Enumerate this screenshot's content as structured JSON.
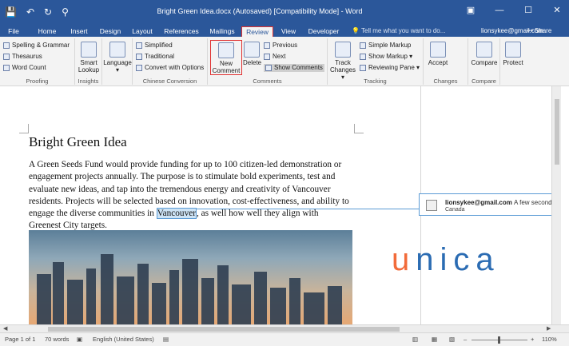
{
  "titlebar": {
    "title": "Bright Green Idea.docx (Autosaved) [Compatibility Mode] - Word",
    "save_icon": "💾",
    "undo_icon": "↶",
    "redo_icon": "↻",
    "qat_more": "⚲",
    "win_ribbon": "▣",
    "win_min": "—",
    "win_max": "☐",
    "win_close": "✕"
  },
  "tabs": [
    "File",
    "Home",
    "Insert",
    "Design",
    "Layout",
    "References",
    "Mailings",
    "Review",
    "View",
    "Developer"
  ],
  "tellme": "💡 Tell me what you want to do...",
  "user": "lionsykee@gmail.com",
  "share": "⚯ Share",
  "ribbon": {
    "proofing": {
      "spelling": "Spelling & Grammar",
      "thesaurus": "Thesaurus",
      "wordcount": "Word Count",
      "label": "Proofing"
    },
    "insights": {
      "smart_lookup_1": "Smart",
      "smart_lookup_2": "Lookup",
      "label": "Insights"
    },
    "language": {
      "btn": "Language",
      "dd": "▾"
    },
    "chinese": {
      "simplified": "Simplified",
      "traditional": "Traditional",
      "convert": "Convert with Options",
      "label": "Chinese Conversion"
    },
    "comments": {
      "new_1": "New",
      "new_2": "Comment",
      "delete": "Delete",
      "previous": "Previous",
      "next": "Next",
      "show": "Show Comments",
      "label": "Comments"
    },
    "tracking": {
      "track_1": "Track",
      "track_2": "Changes ▾",
      "markup": "Simple Markup",
      "show_markup": "Show Markup ▾",
      "reviewing": "Reviewing Pane ▾",
      "label": "Tracking"
    },
    "changes": {
      "accept": "Accept",
      "label": "Changes"
    },
    "compare": {
      "btn": "Compare",
      "label": "Compare"
    },
    "protect": {
      "btn": "Protect"
    }
  },
  "document": {
    "heading": "Bright Green Idea",
    "para_1": " A Green Seeds Fund would provide funding for up to 100 citizen-led demonstration or engagement projects annually. The purpose is to stimulate bold experiments, test and evaluate new ideas, and tap into the tremendous energy and creativity of Vancouver residents. Projects will be selected based on innovation, cost-effectiveness, and ability to engage the diverse communities in ",
    "highlight": "Vancouver",
    "para_2": ", as well how well they align with Greenest City targets."
  },
  "comment": {
    "user": "lionsykee@gmail.com",
    "time": "A few seconds",
    "location": "Canada"
  },
  "watermark": {
    "u": "u",
    "rest": "nica"
  },
  "status": {
    "page": "Page 1 of 1",
    "words": "70 words",
    "language": "English (United States)",
    "zoom_minus": "–",
    "zoom_plus": "+",
    "zoom": "110%"
  },
  "colors": {
    "brand": "#2b579a",
    "accent_red": "#e03131",
    "unica_orange": "#f26b3a",
    "unica_blue": "#2b6cb3"
  },
  "zoom_level_percent": 110
}
